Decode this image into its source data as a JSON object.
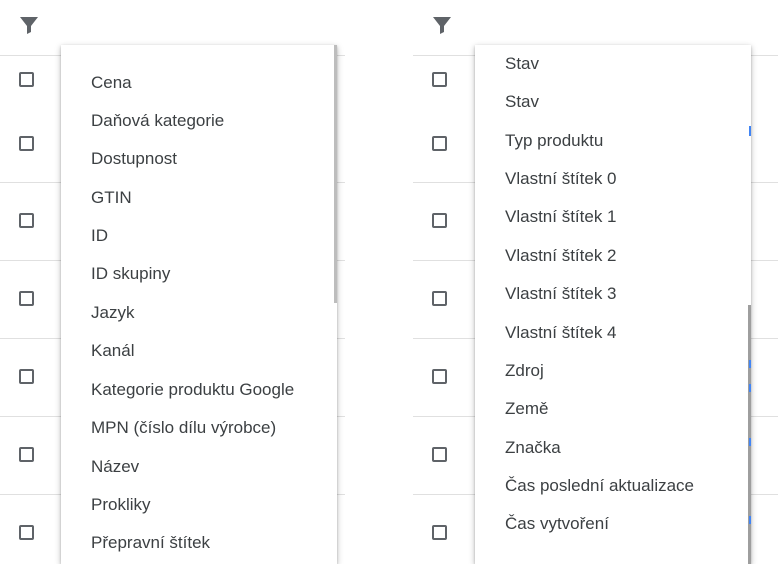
{
  "left_panel": {
    "menu_items": [
      "Cena",
      "Daňová kategorie",
      "Dostupnost",
      "GTIN",
      "ID",
      "ID skupiny",
      "Jazyk",
      "Kanál",
      "Kategorie produktu Google",
      "MPN (číslo dílu výrobce)",
      "Název",
      "Prokliky",
      "Přepravní štítek"
    ]
  },
  "right_panel": {
    "menu_items": [
      "Stav",
      "Stav",
      "Typ produktu",
      "Vlastní štítek 0",
      "Vlastní štítek 1",
      "Vlastní štítek 2",
      "Vlastní štítek 3",
      "Vlastní štítek 4",
      "Zdroj",
      "Země",
      "Značka",
      "Čas poslední aktualizace",
      "Čas vytvoření"
    ]
  },
  "icons": {
    "filter": "filter-icon",
    "checkbox": "checkbox-icon"
  },
  "colors": {
    "icon": "#5f6368",
    "text": "#3c4043",
    "divider": "#e0e0e0"
  }
}
